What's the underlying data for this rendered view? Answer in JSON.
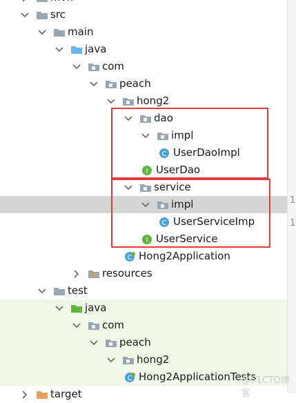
{
  "tree": {
    "items": [
      {
        "label": "mvn",
        "indent": 0,
        "icon": "folder-icon",
        "expanded": false
      },
      {
        "label": "src",
        "indent": 0,
        "icon": "folder-icon",
        "expanded": true
      },
      {
        "label": "main",
        "indent": 1,
        "icon": "folder-icon",
        "expanded": true
      },
      {
        "label": "java",
        "indent": 2,
        "icon": "source-folder-icon",
        "expanded": true
      },
      {
        "label": "com",
        "indent": 3,
        "icon": "package-icon",
        "expanded": true
      },
      {
        "label": "peach",
        "indent": 4,
        "icon": "package-icon",
        "expanded": true
      },
      {
        "label": "hong2",
        "indent": 5,
        "icon": "package-icon",
        "expanded": true
      },
      {
        "label": "dao",
        "indent": 6,
        "icon": "package-icon",
        "expanded": true
      },
      {
        "label": "impl",
        "indent": 7,
        "icon": "package-icon",
        "expanded": true
      },
      {
        "label": "UserDaoImpl",
        "indent": 8,
        "icon": "class-icon",
        "expanded": null
      },
      {
        "label": "UserDao",
        "indent": 7,
        "icon": "interface-icon",
        "expanded": null
      },
      {
        "label": "service",
        "indent": 6,
        "icon": "package-icon",
        "expanded": true
      },
      {
        "label": "impl",
        "indent": 7,
        "icon": "package-icon",
        "expanded": true,
        "selected": true
      },
      {
        "label": "UserServiceImp",
        "indent": 8,
        "icon": "class-icon",
        "expanded": null
      },
      {
        "label": "UserService",
        "indent": 7,
        "icon": "interface-icon",
        "expanded": null
      },
      {
        "label": "Hong2Application",
        "indent": 6,
        "icon": "spring-app-icon",
        "expanded": null
      },
      {
        "label": "resources",
        "indent": 3,
        "icon": "resources-folder-icon",
        "expanded": false
      },
      {
        "label": "test",
        "indent": 1,
        "icon": "folder-icon",
        "expanded": true
      },
      {
        "label": "java",
        "indent": 2,
        "icon": "test-source-folder-icon",
        "expanded": true,
        "test": true
      },
      {
        "label": "com",
        "indent": 3,
        "icon": "package-icon",
        "expanded": true,
        "test": true
      },
      {
        "label": "peach",
        "indent": 4,
        "icon": "package-icon",
        "expanded": true,
        "test": true
      },
      {
        "label": "hong2",
        "indent": 5,
        "icon": "package-icon",
        "expanded": true,
        "test": true
      },
      {
        "label": "Hong2ApplicationTests",
        "indent": 6,
        "icon": "spring-app-icon",
        "expanded": null,
        "test": true
      },
      {
        "label": "target",
        "indent": 0,
        "icon": "excluded-folder-icon",
        "expanded": false
      }
    ]
  },
  "gutter": {
    "numbers": [
      "1",
      "1"
    ]
  },
  "watermark": "@51CTO博客",
  "colors": {
    "highlight_box": "#e33a3a",
    "selection": "#d6d6d6",
    "test_background": "#f1f8e9",
    "package_folder": "#9aa7b0",
    "source_folder": "#6ab7e6",
    "test_folder": "#62b543",
    "class_circle": "#4aa3df",
    "interface_circle": "#62b543"
  }
}
